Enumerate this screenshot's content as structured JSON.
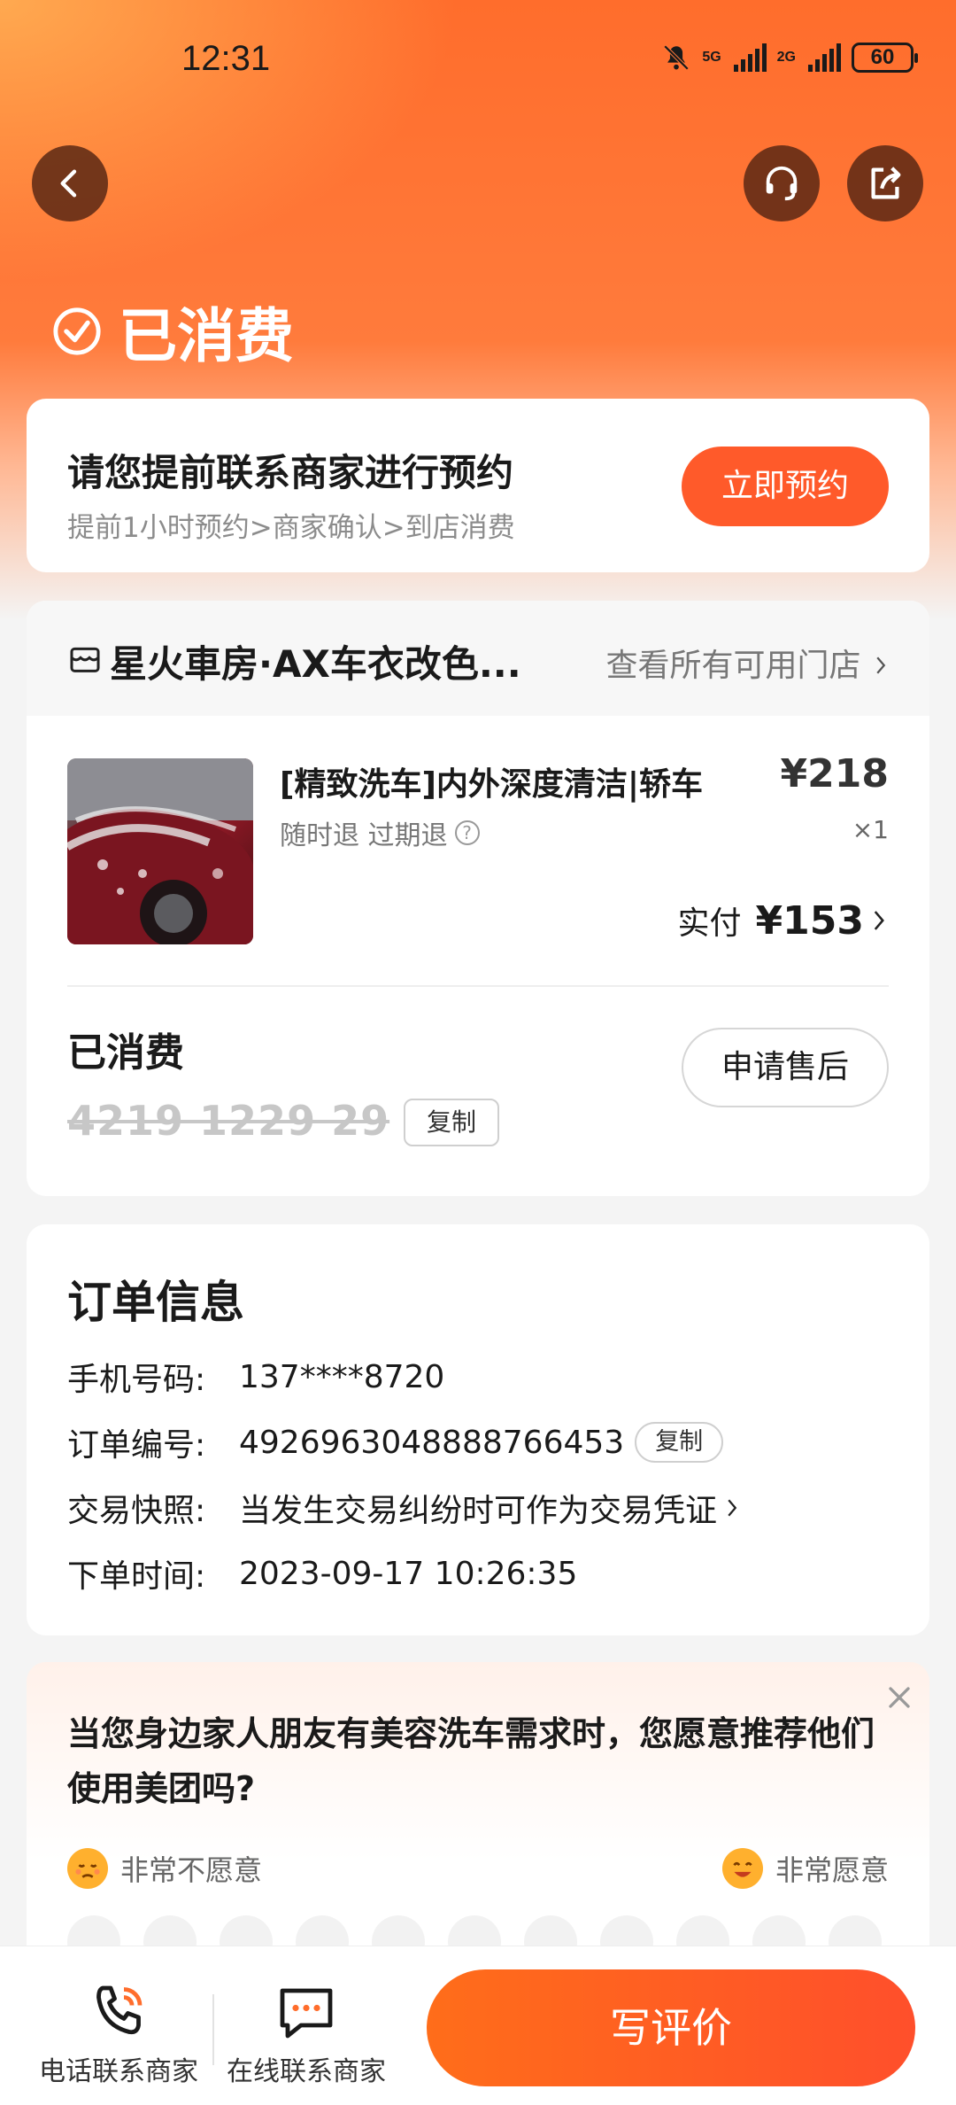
{
  "status_bar": {
    "time": "12:31",
    "net1": "5G",
    "net2": "2G",
    "battery": "60"
  },
  "header": {
    "status_text": "已消费"
  },
  "reservation": {
    "title": "请您提前联系商家进行预约",
    "steps": "提前1小时预约>商家确认>到店消费",
    "button": "立即预约"
  },
  "shop": {
    "name": "星火車房·AX车衣改色...",
    "view_all": "查看所有可用门店",
    "product": {
      "title": "[精致洗车]内外深度清洁|轿车",
      "refund": "随时退 过期退",
      "price": "¥218",
      "qty": "×1",
      "paid_label": "实付",
      "paid_amount": "¥153"
    },
    "coupon": {
      "status": "已消费",
      "code": "4219 1229 29",
      "copy": "复制",
      "after_sale": "申请售后"
    }
  },
  "order_info": {
    "title": "订单信息",
    "rows": [
      {
        "key": "手机号码:",
        "value": "137****8720"
      },
      {
        "key": "订单编号:",
        "value": "4926963048888766453",
        "action": "复制"
      },
      {
        "key": "交易快照:",
        "value": "当发生交易纠纷时可作为交易凭证"
      },
      {
        "key": "下单时间:",
        "value": "2023-09-17 10:26:35"
      }
    ]
  },
  "survey": {
    "question": "当您身边家人朋友有美容洗车需求时，您愿意推荐他们使用美团吗?",
    "low_label": "非常不愿意",
    "high_label": "非常愿意"
  },
  "bottom_bar": {
    "phone": "电话联系商家",
    "chat": "在线联系商家",
    "review": "写评价"
  },
  "colors": {
    "accent": "#ff5a2a",
    "header": "#ff7b3c"
  }
}
